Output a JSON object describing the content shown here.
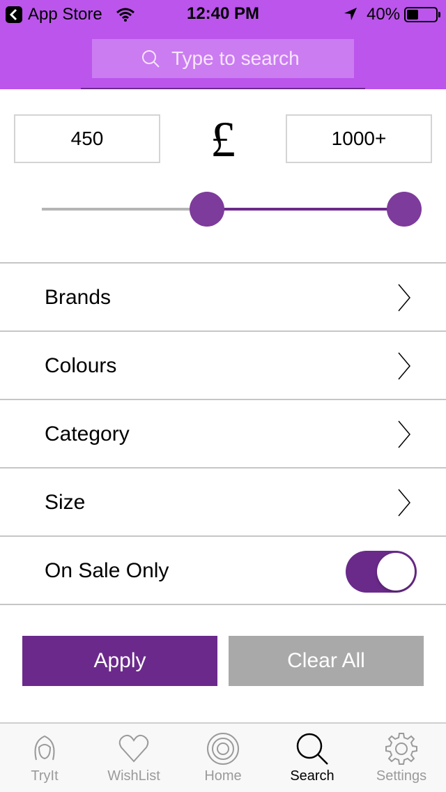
{
  "status_bar": {
    "back_label": "App Store",
    "time": "12:40 PM",
    "battery_percent": "40%",
    "battery_level": 0.4
  },
  "search": {
    "placeholder": "Type to search"
  },
  "price": {
    "min": "450",
    "max": "1000+",
    "currency": "£",
    "slider_low_fraction": 0.455,
    "slider_high_fraction": 1.0
  },
  "filters": [
    {
      "label": "Brands"
    },
    {
      "label": "Colours"
    },
    {
      "label": "Category"
    },
    {
      "label": "Size"
    }
  ],
  "on_sale": {
    "label": "On Sale Only",
    "enabled": true
  },
  "actions": {
    "apply_label": "Apply",
    "clear_label": "Clear All"
  },
  "tabs": [
    {
      "label": "TryIt",
      "icon": "face-icon"
    },
    {
      "label": "WishList",
      "icon": "heart-icon"
    },
    {
      "label": "Home",
      "icon": "target-icon"
    },
    {
      "label": "Search",
      "icon": "search-icon",
      "active": true
    },
    {
      "label": "Settings",
      "icon": "gear-icon"
    }
  ],
  "colors": {
    "header": "#bb55ec",
    "accent": "#6b2a8b",
    "clear_button": "#a9a9a9"
  }
}
